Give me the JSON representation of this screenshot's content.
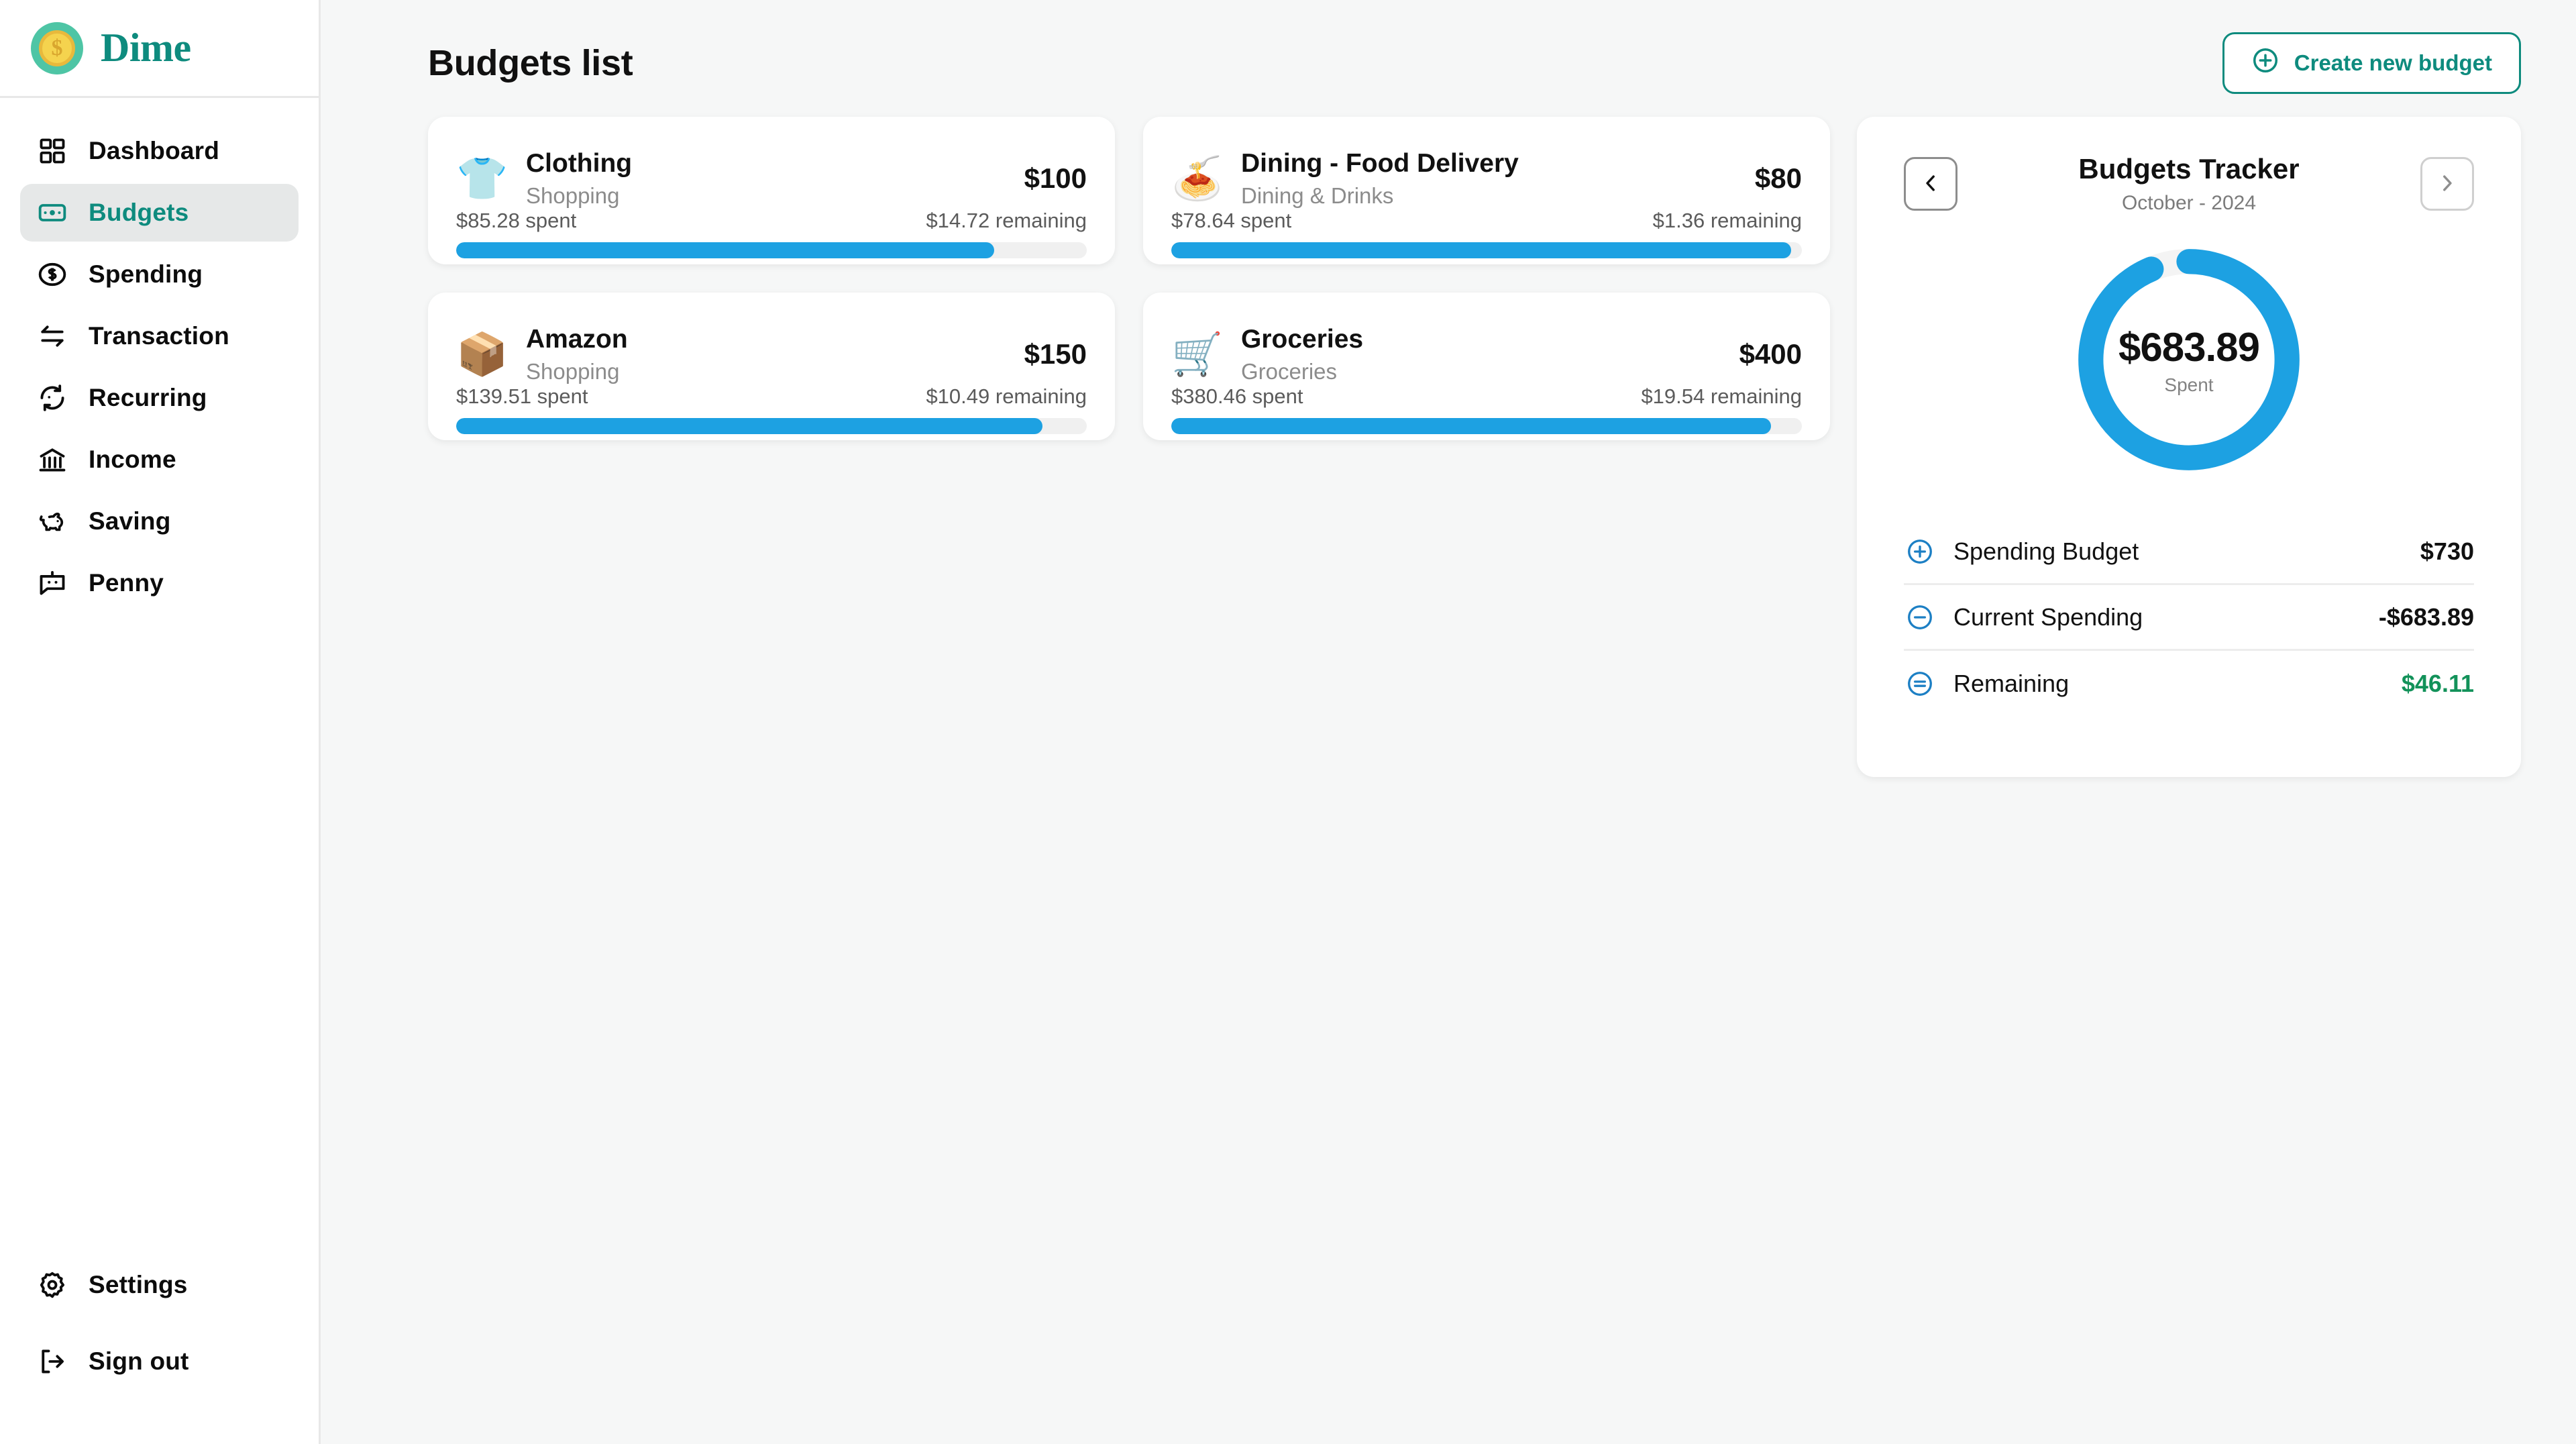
{
  "brand": {
    "name": "Dime",
    "logo_icon": "dollar-coin-icon",
    "coin_symbol": "$",
    "accent": "#0e8b7e"
  },
  "sidebar": {
    "items": [
      {
        "label": "Dashboard",
        "icon": "grid-icon",
        "active": false
      },
      {
        "label": "Budgets",
        "icon": "banknote-icon",
        "active": true
      },
      {
        "label": "Spending",
        "icon": "dollar-circle-icon",
        "active": false
      },
      {
        "label": "Transaction",
        "icon": "transfer-arrows-icon",
        "active": false
      },
      {
        "label": "Recurring",
        "icon": "refresh-icon",
        "active": false
      },
      {
        "label": "Income",
        "icon": "bank-icon",
        "active": false
      },
      {
        "label": "Saving",
        "icon": "piggy-bank-icon",
        "active": false
      },
      {
        "label": "Penny",
        "icon": "chat-bot-icon",
        "active": false
      }
    ],
    "bottom_items": [
      {
        "label": "Settings",
        "icon": "gear-icon"
      },
      {
        "label": "Sign out",
        "icon": "sign-out-icon"
      }
    ]
  },
  "header": {
    "title": "Budgets list",
    "create_button": {
      "label": "Create new budget",
      "icon": "plus-circle-icon"
    }
  },
  "budgets": [
    {
      "name": "Clothing",
      "category": "Shopping",
      "emoji": "👕",
      "emoji_name": "tshirt-icon",
      "amount": "$100",
      "spent_text": "$85.28 spent",
      "remaining_text": "$14.72 remaining",
      "percent": 85.28
    },
    {
      "name": "Dining - Food Delivery",
      "category": "Dining & Drinks",
      "emoji": "🍝",
      "emoji_name": "takeout-food-icon",
      "amount": "$80",
      "spent_text": "$78.64 spent",
      "remaining_text": "$1.36 remaining",
      "percent": 98.3
    },
    {
      "name": "Amazon",
      "category": "Shopping",
      "emoji": "📦",
      "emoji_name": "package-box-icon",
      "amount": "$150",
      "spent_text": "$139.51 spent",
      "remaining_text": "$10.49 remaining",
      "percent": 93.0
    },
    {
      "name": "Groceries",
      "category": "Groceries",
      "emoji": "🛒",
      "emoji_name": "shopping-cart-icon",
      "amount": "$400",
      "spent_text": "$380.46 spent",
      "remaining_text": "$19.54 remaining",
      "percent": 95.1
    }
  ],
  "tracker": {
    "title": "Budgets Tracker",
    "period": "October - 2024",
    "prev_icon": "chevron-left-icon",
    "next_icon": "chevron-right-icon",
    "donut": {
      "value": "$683.89",
      "label": "Spent"
    },
    "summary": [
      {
        "icon": "plus-circle-icon",
        "label": "Spending Budget",
        "value": "$730",
        "green": false
      },
      {
        "icon": "minus-circle-icon",
        "label": "Current Spending",
        "value": "-$683.89",
        "green": false
      },
      {
        "icon": "equals-circle-icon",
        "label": "Remaining",
        "value": "$46.11",
        "green": true
      }
    ]
  },
  "chart_data": {
    "type": "pie",
    "title": "Budgets Tracker",
    "subtitle": "October - 2024",
    "categories": [
      "Spent",
      "Remaining"
    ],
    "values": [
      683.89,
      46.11
    ],
    "total": 730,
    "center_label": "$683.89",
    "center_sublabel": "Spent",
    "colors": [
      "#1da1e2",
      "#f4f4f4"
    ],
    "legend": "none"
  },
  "colors": {
    "accent_teal": "#0e8b7e",
    "progress_blue": "#1da1e2",
    "positive_green": "#13925a",
    "page_bg": "#f6f7f7",
    "card_bg": "#ffffff"
  }
}
